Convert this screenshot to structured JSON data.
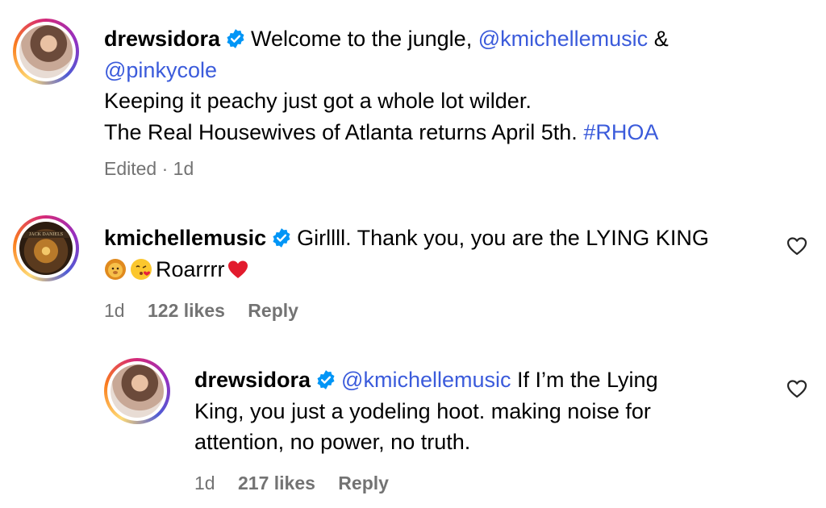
{
  "comments": [
    {
      "username": "drewsidora",
      "text_parts": {
        "intro": "Welcome to the jungle,",
        "mention1": "@kmichellemusic",
        "amp": "&",
        "mention2": "@pinkycole",
        "line2": "Keeping it peachy just got a whole lot wilder.",
        "line3": "The Real Housewives of Atlanta returns April 5th.",
        "hashtag": "#RHOA"
      },
      "meta": "Edited · 1d"
    },
    {
      "username": "kmichellemusic",
      "avatar_caption": "JACK DANIELS",
      "text_parts": {
        "line1": "Girllll. Thank you, you are the LYING KING",
        "line2": "Roarrrr"
      },
      "time": "1d",
      "likes": "122 likes",
      "reply": "Reply"
    },
    {
      "username": "drewsidora",
      "text_parts": {
        "mention": "@kmichellemusic",
        "line1": "If I’m the Lying",
        "line2": "King, you just a yodeling hoot. making noise for",
        "line3": "attention, no power, no truth."
      },
      "time": "1d",
      "likes": "217 likes",
      "reply": "Reply"
    }
  ],
  "colors": {
    "link": "#3b5bdb",
    "meta": "#737373",
    "verified": "#0095f6"
  }
}
